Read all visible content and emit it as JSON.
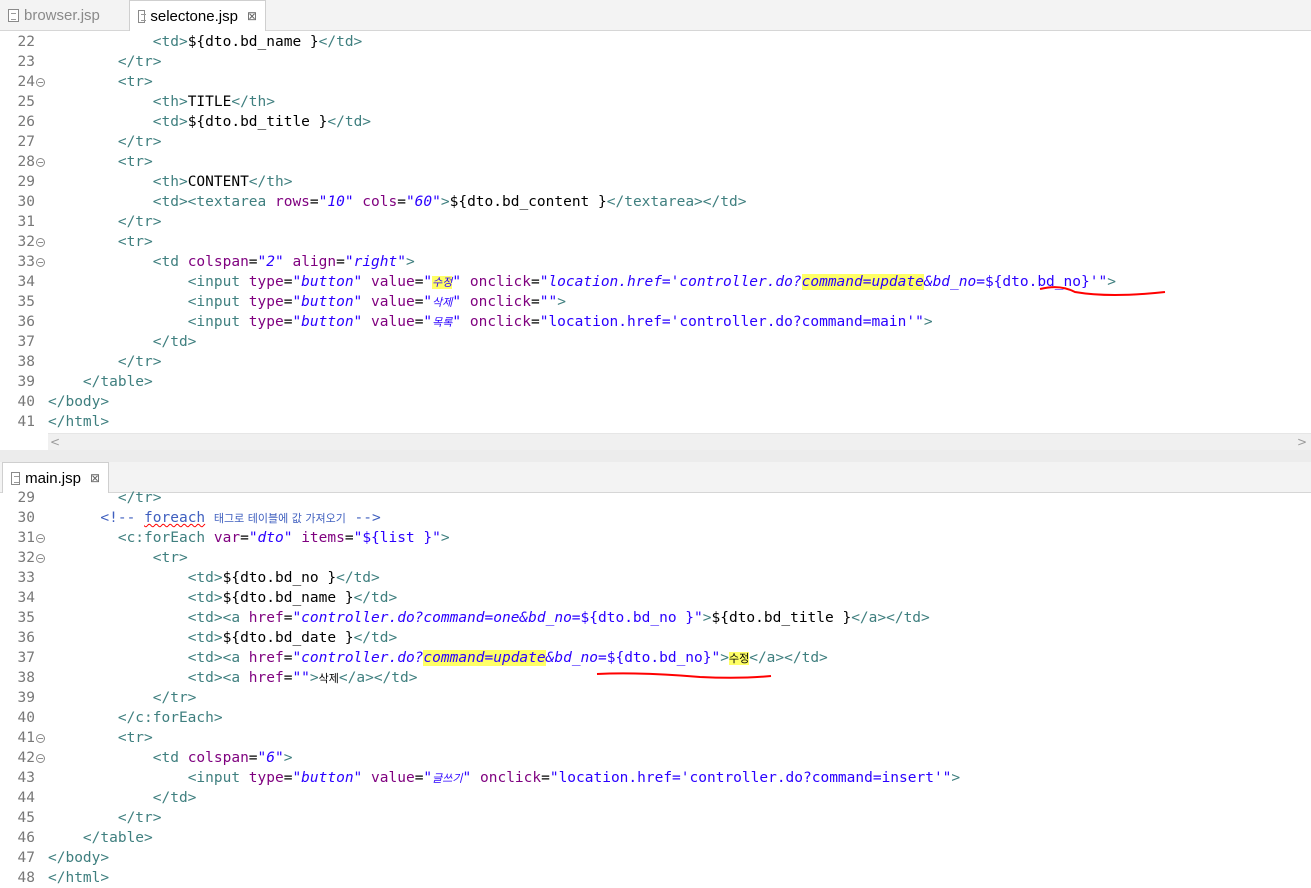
{
  "top_editor": {
    "tabs": [
      {
        "label": "browser.jsp",
        "active": false
      },
      {
        "label": "selectone.jsp",
        "active": true
      }
    ],
    "close_glyph": "⊠",
    "lines": [
      {
        "n": "22",
        "fold": false,
        "code": [
          [
            "",
            "            "
          ],
          [
            "tg",
            "<td>"
          ],
          [
            "",
            "${dto.bd_name }"
          ],
          [
            "tg",
            "</td>"
          ]
        ]
      },
      {
        "n": "23",
        "fold": false,
        "code": [
          [
            "",
            "        "
          ],
          [
            "tg",
            "</tr>"
          ]
        ]
      },
      {
        "n": "24",
        "fold": true,
        "code": [
          [
            "",
            "        "
          ],
          [
            "tg",
            "<tr>"
          ]
        ]
      },
      {
        "n": "25",
        "fold": false,
        "code": [
          [
            "",
            "            "
          ],
          [
            "tg",
            "<th>"
          ],
          [
            "",
            "TITLE"
          ],
          [
            "tg",
            "</th>"
          ]
        ]
      },
      {
        "n": "26",
        "fold": false,
        "code": [
          [
            "",
            "            "
          ],
          [
            "tg",
            "<td>"
          ],
          [
            "",
            "${dto.bd_title }"
          ],
          [
            "tg",
            "</td>"
          ]
        ]
      },
      {
        "n": "27",
        "fold": false,
        "code": [
          [
            "",
            "        "
          ],
          [
            "tg",
            "</tr>"
          ]
        ]
      },
      {
        "n": "28",
        "fold": true,
        "code": [
          [
            "",
            "        "
          ],
          [
            "tg",
            "<tr>"
          ]
        ]
      },
      {
        "n": "29",
        "fold": false,
        "code": [
          [
            "",
            "            "
          ],
          [
            "tg",
            "<th>"
          ],
          [
            "",
            "CONTENT"
          ],
          [
            "tg",
            "</th>"
          ]
        ]
      },
      {
        "n": "30",
        "fold": false,
        "code": [
          [
            "",
            "            "
          ],
          [
            "tg",
            "<td><textarea "
          ],
          [
            "at",
            "rows"
          ],
          [
            "",
            "="
          ],
          [
            "sv",
            "\"10\""
          ],
          [
            "",
            " "
          ],
          [
            "at",
            "cols"
          ],
          [
            "",
            "="
          ],
          [
            "sv",
            "\"60\""
          ],
          [
            "tg",
            ">"
          ],
          [
            "",
            "${dto.bd_content }"
          ],
          [
            "tg",
            "</textarea></td>"
          ]
        ]
      },
      {
        "n": "31",
        "fold": false,
        "code": [
          [
            "",
            "        "
          ],
          [
            "tg",
            "</tr>"
          ]
        ]
      },
      {
        "n": "32",
        "fold": true,
        "code": [
          [
            "",
            "        "
          ],
          [
            "tg",
            "<tr>"
          ]
        ]
      },
      {
        "n": "33",
        "fold": true,
        "code": [
          [
            "",
            "            "
          ],
          [
            "tg",
            "<td "
          ],
          [
            "at",
            "colspan"
          ],
          [
            "",
            "="
          ],
          [
            "sv",
            "\"2\""
          ],
          [
            "",
            " "
          ],
          [
            "at",
            "align"
          ],
          [
            "",
            "="
          ],
          [
            "sv",
            "\"right\""
          ],
          [
            "tg",
            ">"
          ]
        ]
      },
      {
        "n": "34",
        "fold": false,
        "code": [
          [
            "",
            "                "
          ],
          [
            "tg",
            "<input "
          ],
          [
            "at",
            "type"
          ],
          [
            "",
            "="
          ],
          [
            "sv",
            "\"button\""
          ],
          [
            "",
            " "
          ],
          [
            "at",
            "value"
          ],
          [
            "",
            "="
          ],
          [
            "sv",
            "\""
          ],
          [
            "sv kr hl",
            "수정"
          ],
          [
            "sv",
            "\""
          ],
          [
            "",
            " "
          ],
          [
            "at",
            "onclick"
          ],
          [
            "",
            "="
          ],
          [
            "sv",
            "\"location.href='controller.do?"
          ],
          [
            "sv hl",
            "command=update"
          ],
          [
            "sv",
            "&bd_no="
          ],
          [
            "sn",
            "${dto.bd_no}"
          ],
          [
            "sv",
            "'\""
          ],
          [
            "tg",
            ">"
          ]
        ]
      },
      {
        "n": "35",
        "fold": false,
        "code": [
          [
            "",
            "                "
          ],
          [
            "tg",
            "<input "
          ],
          [
            "at",
            "type"
          ],
          [
            "",
            "="
          ],
          [
            "sv",
            "\"button\""
          ],
          [
            "",
            " "
          ],
          [
            "at",
            "value"
          ],
          [
            "",
            "="
          ],
          [
            "sv",
            "\""
          ],
          [
            "sv kr",
            "삭제"
          ],
          [
            "sv",
            "\""
          ],
          [
            "",
            " "
          ],
          [
            "at",
            "onclick"
          ],
          [
            "",
            "="
          ],
          [
            "sn",
            "\"\""
          ],
          [
            "tg",
            ">"
          ]
        ]
      },
      {
        "n": "36",
        "fold": false,
        "code": [
          [
            "",
            "                "
          ],
          [
            "tg",
            "<input "
          ],
          [
            "at",
            "type"
          ],
          [
            "",
            "="
          ],
          [
            "sv",
            "\"button\""
          ],
          [
            "",
            " "
          ],
          [
            "at",
            "value"
          ],
          [
            "",
            "="
          ],
          [
            "sv",
            "\""
          ],
          [
            "sv kr",
            "목록"
          ],
          [
            "sv",
            "\""
          ],
          [
            "",
            " "
          ],
          [
            "at",
            "onclick"
          ],
          [
            "",
            "="
          ],
          [
            "sn",
            "\"location.href='controller.do?command=main'\""
          ],
          [
            "tg",
            ">"
          ]
        ]
      },
      {
        "n": "37",
        "fold": false,
        "code": [
          [
            "",
            "            "
          ],
          [
            "tg",
            "</td>"
          ]
        ]
      },
      {
        "n": "38",
        "fold": false,
        "code": [
          [
            "",
            "        "
          ],
          [
            "tg",
            "</tr>"
          ]
        ]
      },
      {
        "n": "39",
        "fold": false,
        "code": [
          [
            "",
            "    "
          ],
          [
            "tg",
            "</table>"
          ]
        ]
      },
      {
        "n": "40",
        "fold": false,
        "code": [
          [
            "tg",
            "</body>"
          ]
        ]
      },
      {
        "n": "41",
        "fold": false,
        "code": [
          [
            "tg",
            "</html>"
          ]
        ]
      }
    ]
  },
  "bottom_editor": {
    "tabs": [
      {
        "label": "main.jsp",
        "active": true
      }
    ],
    "close_glyph": "⊠",
    "lines": [
      {
        "n": "29",
        "fold": false,
        "code": [
          [
            "",
            "        "
          ],
          [
            "tg",
            "</tr>"
          ]
        ]
      },
      {
        "n": "30",
        "fold": false,
        "code": [
          [
            "",
            "      "
          ],
          [
            "cm",
            "<!-- "
          ],
          [
            "cm squig",
            "foreach"
          ],
          [
            "cm",
            " "
          ],
          [
            "cm kr",
            "태그로 테이블에 값 가져오기"
          ],
          [
            "cm",
            " -->"
          ]
        ]
      },
      {
        "n": "31",
        "fold": true,
        "code": [
          [
            "",
            "        "
          ],
          [
            "tg",
            "<c:forEach "
          ],
          [
            "at",
            "var"
          ],
          [
            "",
            "="
          ],
          [
            "sv",
            "\"dto\""
          ],
          [
            "",
            " "
          ],
          [
            "at",
            "items"
          ],
          [
            "",
            "="
          ],
          [
            "sn",
            "\"${list }\""
          ],
          [
            "tg",
            ">"
          ]
        ]
      },
      {
        "n": "32",
        "fold": true,
        "code": [
          [
            "",
            "            "
          ],
          [
            "tg",
            "<tr>"
          ]
        ]
      },
      {
        "n": "33",
        "fold": false,
        "code": [
          [
            "",
            "                "
          ],
          [
            "tg",
            "<td>"
          ],
          [
            "",
            "${dto.bd_no }"
          ],
          [
            "tg",
            "</td>"
          ]
        ]
      },
      {
        "n": "34",
        "fold": false,
        "code": [
          [
            "",
            "                "
          ],
          [
            "tg",
            "<td>"
          ],
          [
            "",
            "${dto.bd_name }"
          ],
          [
            "tg",
            "</td>"
          ]
        ]
      },
      {
        "n": "35",
        "fold": false,
        "code": [
          [
            "",
            "                "
          ],
          [
            "tg",
            "<td><a "
          ],
          [
            "at",
            "href"
          ],
          [
            "",
            "="
          ],
          [
            "sv",
            "\"controller.do?command=one&bd_no="
          ],
          [
            "sn",
            "${dto.bd_no }"
          ],
          [
            "sv",
            "\""
          ],
          [
            "tg",
            ">"
          ],
          [
            "",
            "${dto.bd_title }"
          ],
          [
            "tg",
            "</a></td>"
          ]
        ]
      },
      {
        "n": "36",
        "fold": false,
        "code": [
          [
            "",
            "                "
          ],
          [
            "tg",
            "<td>"
          ],
          [
            "",
            "${dto.bd_date }"
          ],
          [
            "tg",
            "</td>"
          ]
        ]
      },
      {
        "n": "37",
        "fold": false,
        "code": [
          [
            "",
            "                "
          ],
          [
            "tg",
            "<td><a "
          ],
          [
            "at",
            "href"
          ],
          [
            "",
            "="
          ],
          [
            "sv",
            "\"controller.do?"
          ],
          [
            "sv hl",
            "command=update"
          ],
          [
            "sv",
            "&bd_no="
          ],
          [
            "sn",
            "${dto.bd_no}"
          ],
          [
            "sv",
            "\""
          ],
          [
            "tg",
            ">"
          ],
          [
            "kr hl",
            "수정"
          ],
          [
            "tg",
            "</a></td>"
          ]
        ]
      },
      {
        "n": "38",
        "fold": false,
        "code": [
          [
            "",
            "                "
          ],
          [
            "tg",
            "<td><a "
          ],
          [
            "at",
            "href"
          ],
          [
            "",
            "="
          ],
          [
            "sn",
            "\"\""
          ],
          [
            "tg",
            ">"
          ],
          [
            "kr",
            "삭제"
          ],
          [
            "tg",
            "</a></td>"
          ]
        ]
      },
      {
        "n": "39",
        "fold": false,
        "code": [
          [
            "",
            "            "
          ],
          [
            "tg",
            "</tr>"
          ]
        ]
      },
      {
        "n": "40",
        "fold": false,
        "code": [
          [
            "",
            "        "
          ],
          [
            "tg",
            "</c:forEach>"
          ]
        ]
      },
      {
        "n": "41",
        "fold": true,
        "code": [
          [
            "",
            "        "
          ],
          [
            "tg",
            "<tr>"
          ]
        ]
      },
      {
        "n": "42",
        "fold": true,
        "code": [
          [
            "",
            "            "
          ],
          [
            "tg",
            "<td "
          ],
          [
            "at",
            "colspan"
          ],
          [
            "",
            "="
          ],
          [
            "sv",
            "\"6\""
          ],
          [
            "tg",
            ">"
          ]
        ]
      },
      {
        "n": "43",
        "fold": false,
        "code": [
          [
            "",
            "                "
          ],
          [
            "tg",
            "<input "
          ],
          [
            "at",
            "type"
          ],
          [
            "",
            "="
          ],
          [
            "sv",
            "\"button\""
          ],
          [
            "",
            " "
          ],
          [
            "at",
            "value"
          ],
          [
            "",
            "="
          ],
          [
            "sv",
            "\""
          ],
          [
            "sv kr",
            "글쓰기"
          ],
          [
            "sv",
            "\""
          ],
          [
            "",
            " "
          ],
          [
            "at",
            "onclick"
          ],
          [
            "",
            "="
          ],
          [
            "sn",
            "\"location.href='controller.do?command=insert'\""
          ],
          [
            "tg",
            ">"
          ]
        ]
      },
      {
        "n": "44",
        "fold": false,
        "code": [
          [
            "",
            "            "
          ],
          [
            "tg",
            "</td>"
          ]
        ]
      },
      {
        "n": "45",
        "fold": false,
        "code": [
          [
            "",
            "        "
          ],
          [
            "tg",
            "</tr>"
          ]
        ]
      },
      {
        "n": "46",
        "fold": false,
        "code": [
          [
            "",
            "    "
          ],
          [
            "tg",
            "</table>"
          ]
        ]
      },
      {
        "n": "47",
        "fold": false,
        "code": [
          [
            "tg",
            "</body>"
          ]
        ]
      },
      {
        "n": "48",
        "fold": false,
        "code": [
          [
            "tg",
            "</html>"
          ]
        ]
      }
    ]
  },
  "scrollbar": {
    "left_arrow": "<",
    "right_arrow": ">"
  },
  "colors": {
    "tag": "#3f7f7f",
    "attribute": "#7f007f",
    "string": "#2a00ff",
    "comment": "#3f5fbf",
    "highlight": "#ffff66",
    "annotation": "#ff0000"
  }
}
